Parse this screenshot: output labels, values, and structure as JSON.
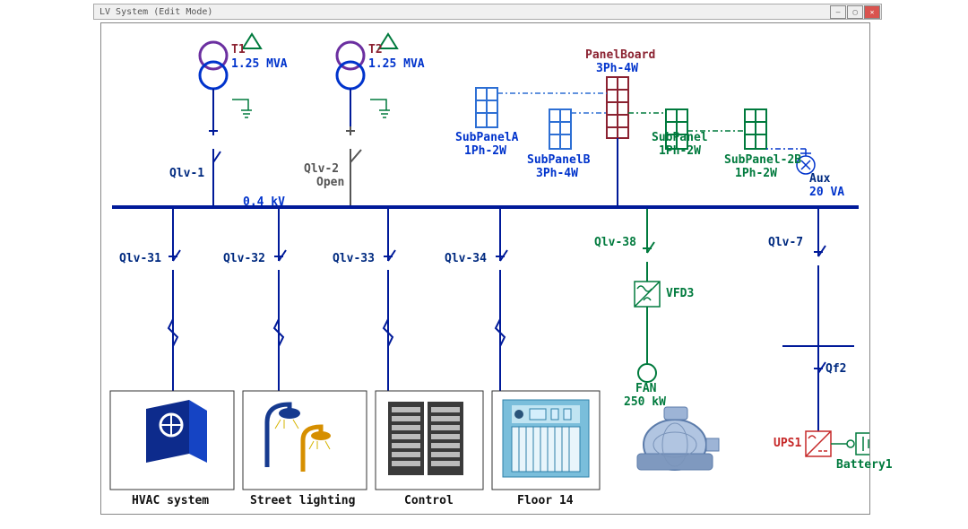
{
  "window": {
    "title": "LV System (Edit Mode)"
  },
  "bus": {
    "voltage": "0.4 kV"
  },
  "transformers": {
    "t1": {
      "name": "T1",
      "rating": "1.25 MVA"
    },
    "t2": {
      "name": "T2",
      "rating": "1.25 MVA"
    }
  },
  "breakers": {
    "qlv1": "Qlv-1",
    "qlv2_name": "Qlv-2",
    "qlv2_state": "Open",
    "qlv31": "Qlv-31",
    "qlv32": "Qlv-32",
    "qlv33": "Qlv-33",
    "qlv34": "Qlv-34",
    "qlv38": "Qlv-38",
    "qlv7": "Qlv-7",
    "qf2": "Qf2"
  },
  "panels": {
    "main_name": "PanelBoard",
    "main_type": "3Ph-4W",
    "subA_name": "SubPanelA",
    "subA_type": "1Ph-2W",
    "subB_name": "SubPanelB",
    "subB_type": "3Ph-4W",
    "sub1_name": "SubPanel",
    "sub1_type": "1Ph-2W",
    "sub2b_name": "SubPanel-2B",
    "sub2b_type": "1Ph-2W"
  },
  "aux": {
    "name": "Aux",
    "rating": "20 VA"
  },
  "vfd": "VFD3",
  "fan": {
    "name": "FAN",
    "rating": "250 kW"
  },
  "ups": "UPS1",
  "battery": "Battery1",
  "loads": {
    "hvac": "HVAC system",
    "street": "Street lighting",
    "control": "Control",
    "floor": "Floor 14"
  }
}
